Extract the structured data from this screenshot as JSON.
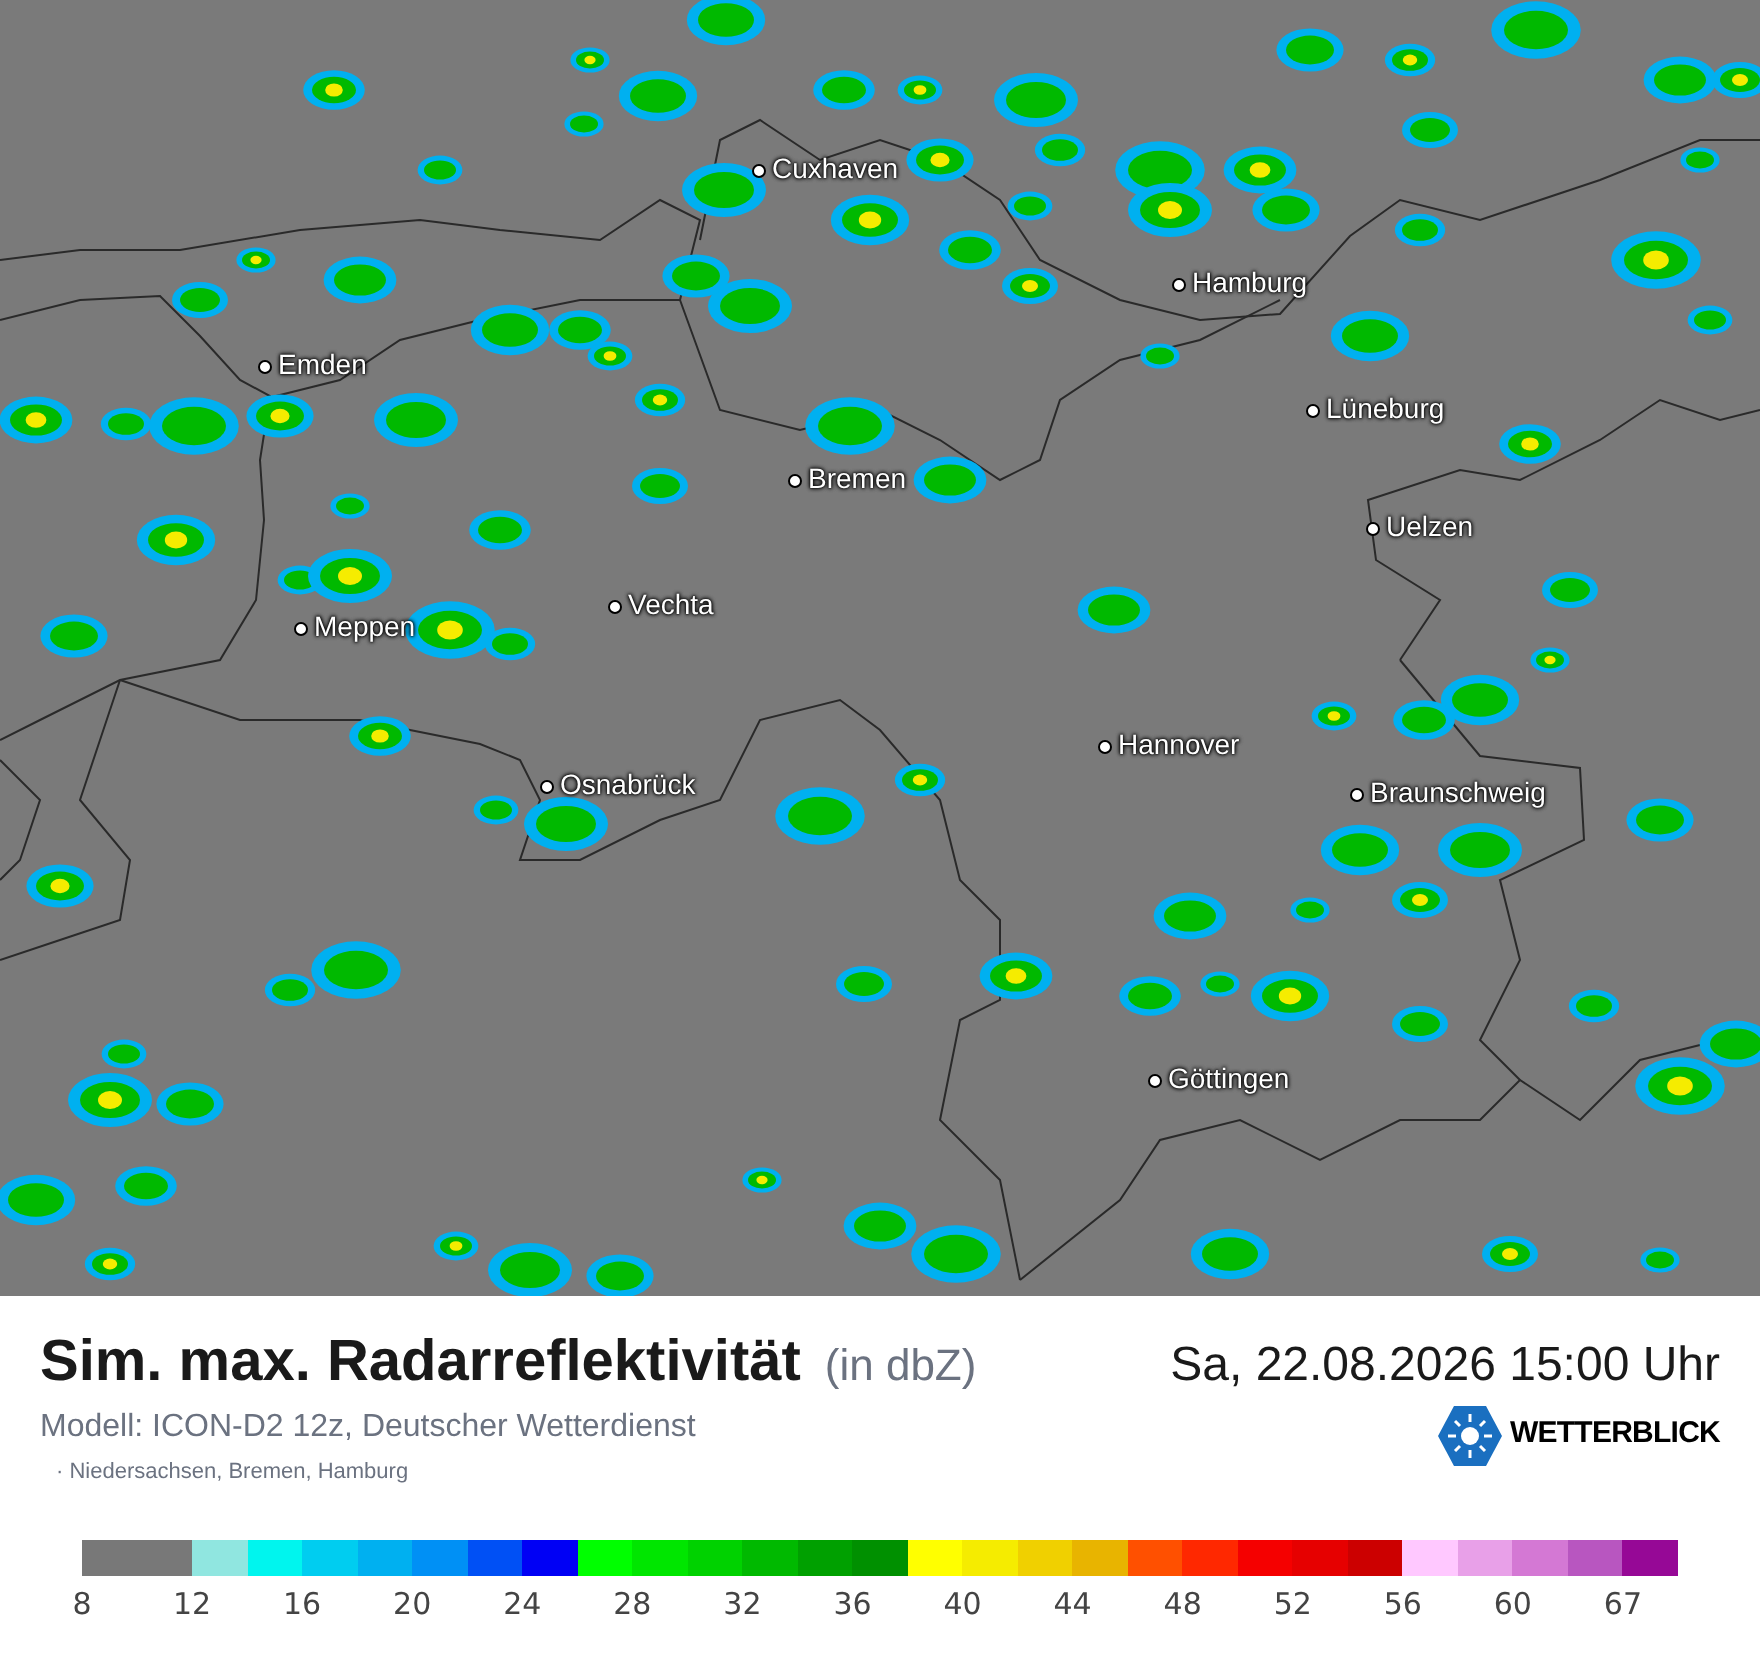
{
  "map": {
    "cities": [
      {
        "name": "Cuxhaven"
      },
      {
        "name": "Hamburg"
      },
      {
        "name": "Emden"
      },
      {
        "name": "Lüneburg"
      },
      {
        "name": "Bremen"
      },
      {
        "name": "Uelzen"
      },
      {
        "name": "Vechta"
      },
      {
        "name": "Meppen"
      },
      {
        "name": "Hannover"
      },
      {
        "name": "Osnabrück"
      },
      {
        "name": "Braunschweig"
      },
      {
        "name": "Göttingen"
      }
    ]
  },
  "header": {
    "title": "Sim. max. Radarreflektivität",
    "unit": "(in dbZ)",
    "datetime": "Sa, 22.08.2026 15:00 Uhr",
    "model": "Modell: ICON-D2 12z, Deutscher Wetterdienst",
    "region": "· Niedersachsen, Bremen, Hamburg",
    "brand": "WETTERBLICK"
  },
  "legend": {
    "segments": [
      {
        "color": "#787878"
      },
      {
        "color": "#787878"
      },
      {
        "color": "#90e6e0"
      },
      {
        "color": "#00f5ee"
      },
      {
        "color": "#00cdf0"
      },
      {
        "color": "#00b0f0"
      },
      {
        "color": "#0090f5"
      },
      {
        "color": "#0050f5"
      },
      {
        "color": "#0000f5"
      },
      {
        "color": "#00ff00"
      },
      {
        "color": "#00e600"
      },
      {
        "color": "#00d200"
      },
      {
        "color": "#00b900"
      },
      {
        "color": "#00a000"
      },
      {
        "color": "#009000"
      },
      {
        "color": "#ffff00"
      },
      {
        "color": "#f5ec00"
      },
      {
        "color": "#f0d000"
      },
      {
        "color": "#e8b400"
      },
      {
        "color": "#ff5000"
      },
      {
        "color": "#ff2800"
      },
      {
        "color": "#f50000"
      },
      {
        "color": "#e60000"
      },
      {
        "color": "#cc0000"
      },
      {
        "color": "#ffc8ff"
      },
      {
        "color": "#e8a0e8"
      },
      {
        "color": "#d478d4"
      },
      {
        "color": "#b856c0"
      },
      {
        "color": "#960896"
      }
    ],
    "ticks": [
      "8",
      "12",
      "16",
      "20",
      "24",
      "28",
      "32",
      "36",
      "40",
      "44",
      "48",
      "52",
      "56",
      "60",
      "67"
    ]
  }
}
